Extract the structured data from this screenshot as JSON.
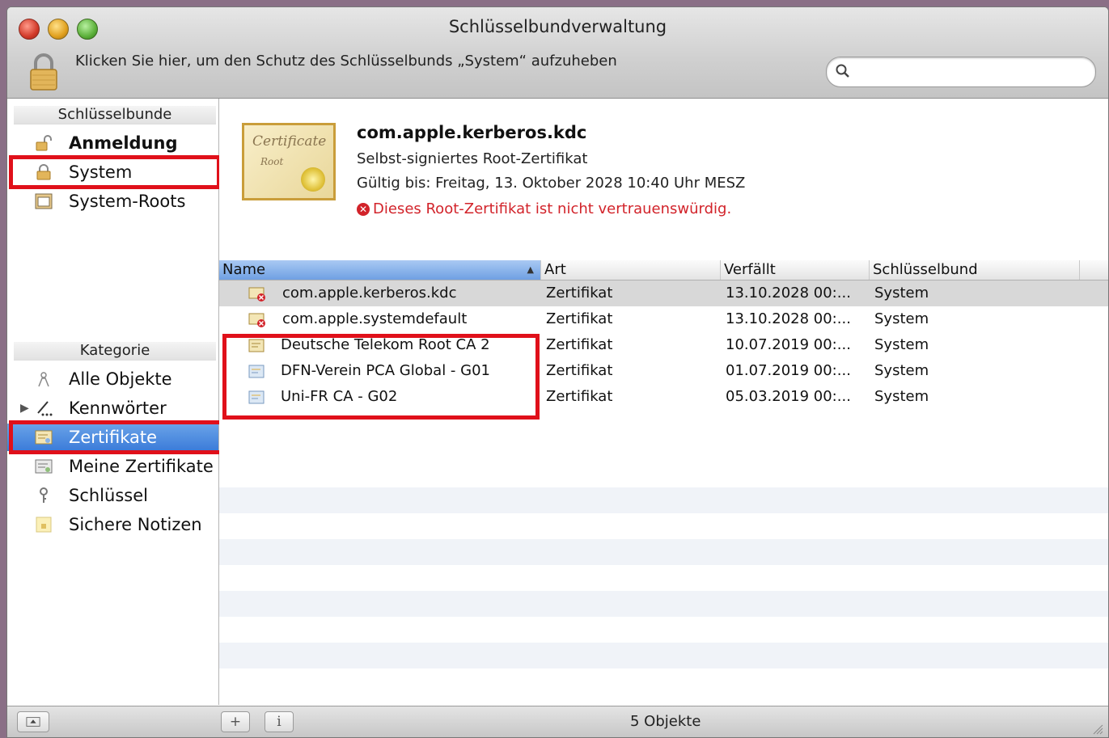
{
  "window": {
    "title": "Schlüsselbundverwaltung"
  },
  "toolbar": {
    "unlock_text": "Klicken Sie hier, um den Schutz des Schlüsselbunds „System“ aufzuheben",
    "search_placeholder": "",
    "search_value": ""
  },
  "sidebar": {
    "keychains_header": "Schlüsselbunde",
    "keychains": [
      {
        "label": "Anmeldung",
        "icon": "unlocked-padlock-icon"
      },
      {
        "label": "System",
        "icon": "locked-padlock-icon"
      },
      {
        "label": "System-Roots",
        "icon": "cabinet-icon"
      }
    ],
    "category_header": "Kategorie",
    "categories": [
      {
        "label": "Alle Objekte",
        "icon": "all-items-icon"
      },
      {
        "label": "Kennwörter",
        "icon": "password-pen-icon"
      },
      {
        "label": "Zertifikate",
        "icon": "certificate-icon"
      },
      {
        "label": "Meine Zertifikate",
        "icon": "my-certificate-icon"
      },
      {
        "label": "Schlüssel",
        "icon": "key-icon"
      },
      {
        "label": "Sichere Notizen",
        "icon": "secure-note-icon"
      }
    ]
  },
  "detail": {
    "image_script": "Certificate",
    "image_root": "Root",
    "title": "com.apple.kerberos.kdc",
    "subtitle": "Selbst-signiertes Root-Zertifikat",
    "valid": "Gültig bis: Freitag, 13. Oktober 2028 10:40 Uhr MESZ",
    "warning": "Dieses Root-Zertifikat ist nicht vertrauenswürdig."
  },
  "table": {
    "columns": [
      "Name",
      "Art",
      "Verfällt",
      "Schlüsselbund"
    ],
    "rows": [
      {
        "name": "com.apple.kerberos.kdc",
        "art": "Zertifikat",
        "expires": "13.10.2028 00:...",
        "keychain": "System"
      },
      {
        "name": "com.apple.systemdefault",
        "art": "Zertifikat",
        "expires": "13.10.2028 00:...",
        "keychain": "System"
      },
      {
        "name": "Deutsche Telekom Root CA 2",
        "art": "Zertifikat",
        "expires": "10.07.2019 00:...",
        "keychain": "System"
      },
      {
        "name": "DFN-Verein PCA Global - G01",
        "art": "Zertifikat",
        "expires": "01.07.2019 00:...",
        "keychain": "System"
      },
      {
        "name": "Uni-FR CA - G02",
        "art": "Zertifikat",
        "expires": "05.03.2019 00:...",
        "keychain": "System"
      }
    ]
  },
  "statusbar": {
    "add_label": "+",
    "info_label": "i",
    "count": "5 Objekte"
  },
  "colors": {
    "highlight_box": "#e0101a",
    "selection_blue": "#3b7bd9",
    "warning_red": "#d2232a"
  }
}
